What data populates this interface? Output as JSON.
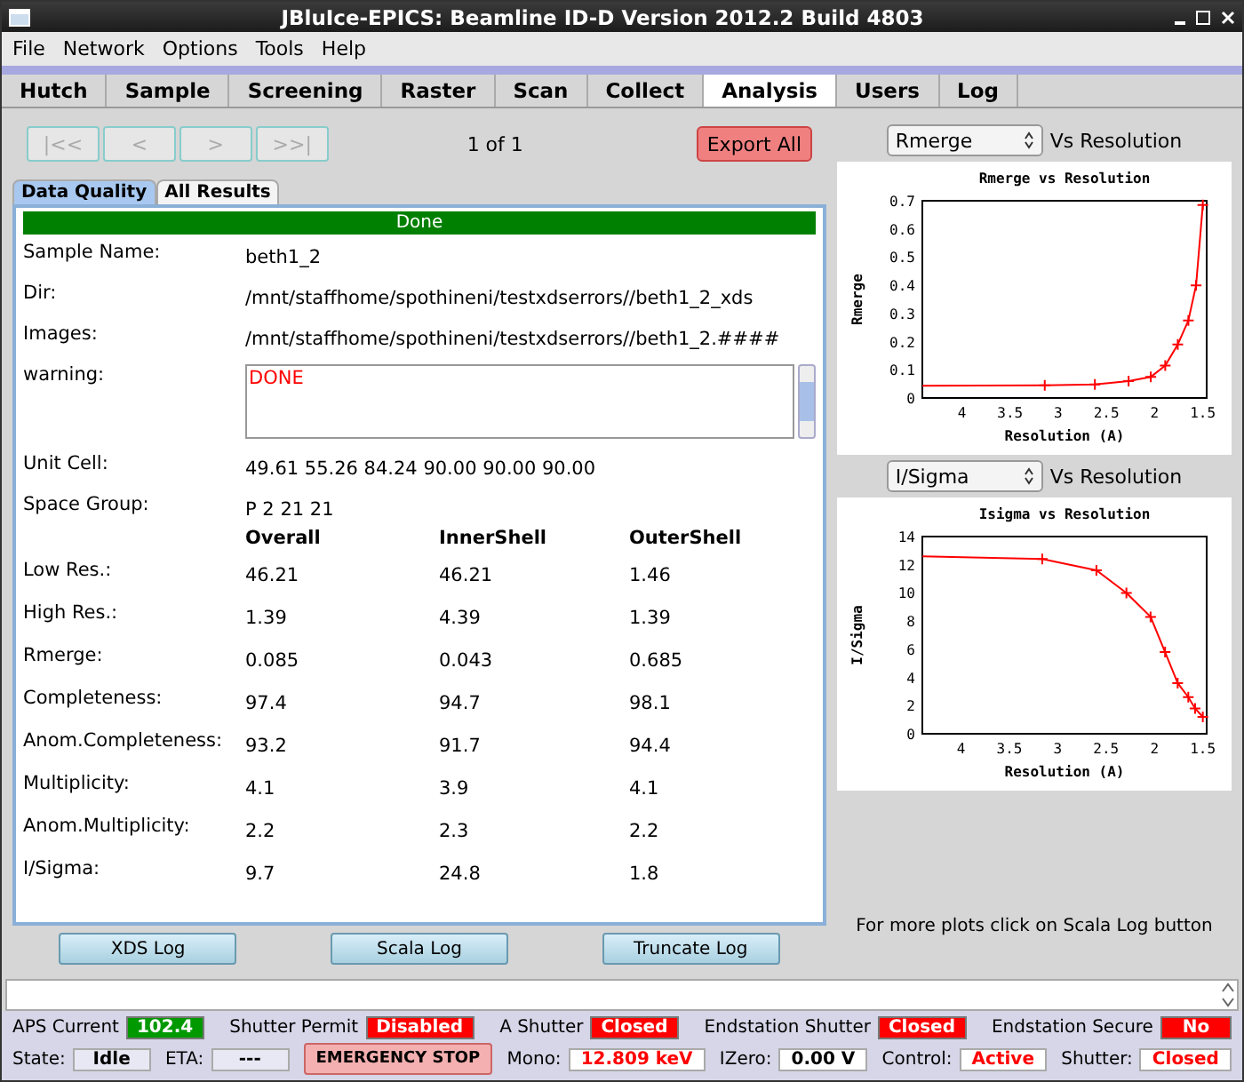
{
  "window": {
    "title": "JBluIce-EPICS: Beamline ID-D Version 2012.2 Build 4803"
  },
  "menu": [
    "File",
    "Network",
    "Options",
    "Tools",
    "Help"
  ],
  "tabs": [
    {
      "label": "Hutch",
      "selected": false
    },
    {
      "label": "Sample",
      "selected": false
    },
    {
      "label": "Screening",
      "selected": false
    },
    {
      "label": "Raster",
      "selected": false
    },
    {
      "label": "Scan",
      "selected": false
    },
    {
      "label": "Collect",
      "selected": false
    },
    {
      "label": "Analysis",
      "selected": true
    },
    {
      "label": "Users",
      "selected": false
    },
    {
      "label": "Log",
      "selected": false
    }
  ],
  "navigation": {
    "buttons": [
      {
        "label": "|<<",
        "disabled": true
      },
      {
        "label": "<",
        "disabled": true
      },
      {
        "label": ">",
        "disabled": true
      },
      {
        "label": ">>|",
        "disabled": true
      }
    ],
    "page": "1 of 1",
    "export": "Export All"
  },
  "subtabs": [
    {
      "label": "Data Quality",
      "selected": true
    },
    {
      "label": "All Results",
      "selected": false
    }
  ],
  "status_banner": "Done",
  "fields": [
    {
      "label": "Sample Name:",
      "value": "beth1_2"
    },
    {
      "label": "Dir:",
      "value": "/mnt/staffhome/spothineni/testxdserrors//beth1_2_xds"
    },
    {
      "label": "Images:",
      "value": "/mnt/staffhome/spothineni/testxdserrors//beth1_2.####"
    }
  ],
  "warning": {
    "label": "warning:",
    "value": "DONE"
  },
  "fields2": [
    {
      "label": "Unit Cell:",
      "value": "49.61  55.26 84.24 90.00 90.00 90.00"
    },
    {
      "label": "Space Group:",
      "value": "P 2 21 21"
    }
  ],
  "stats": {
    "columns": [
      "Overall",
      "InnerShell",
      "OuterShell"
    ],
    "rows": [
      {
        "label": "Low Res.:",
        "values": [
          "46.21",
          "46.21",
          "1.46"
        ]
      },
      {
        "label": "High Res.:",
        "values": [
          "1.39",
          "4.39",
          "1.39"
        ]
      },
      {
        "label": "Rmerge:",
        "values": [
          "0.085",
          "0.043",
          "0.685"
        ]
      },
      {
        "label": "Completeness:",
        "values": [
          "97.4",
          "94.7",
          "98.1"
        ]
      },
      {
        "label": "Anom.Completeness:",
        "values": [
          "93.2",
          "91.7",
          "94.4"
        ]
      },
      {
        "label": "Multiplicity:",
        "values": [
          "4.1",
          "3.9",
          "4.1"
        ]
      },
      {
        "label": "Anom.Multiplicity:",
        "values": [
          "2.2",
          "2.3",
          "2.2"
        ]
      },
      {
        "label": "I/Sigma:",
        "values": [
          "9.7",
          "24.8",
          "1.8"
        ]
      }
    ]
  },
  "log_buttons": [
    "XDS Log",
    "Scala Log",
    "Truncate Log"
  ],
  "plots": [
    {
      "selector": "Rmerge",
      "suffix": "Vs Resolution",
      "chart_data": {
        "type": "line",
        "title": "Rmerge vs Resolution",
        "xlabel": "Resolution (A)",
        "ylabel": "Rmerge",
        "x": [
          4.41,
          3.14,
          2.62,
          2.27,
          2.04,
          1.89,
          1.76,
          1.65,
          1.57,
          1.5
        ],
        "series": [
          {
            "marker": "plus",
            "color": "#ff0000",
            "values": [
              0.043,
              0.045,
              0.048,
              0.06,
              0.075,
              0.115,
              0.19,
              0.275,
              0.4,
              0.685
            ]
          }
        ],
        "xlim": [
          4.41,
          1.46
        ],
        "ylim": [
          0,
          0.7
        ],
        "xticks": [
          4,
          3.5,
          3,
          2.5,
          2,
          1.5
        ],
        "yticks": [
          0,
          0.1,
          0.2,
          0.3,
          0.4,
          0.5,
          0.6,
          0.7
        ]
      }
    },
    {
      "selector": "I/Sigma",
      "suffix": "Vs Resolution",
      "chart_data": {
        "type": "line",
        "title": "Isigma vs Resolution",
        "xlabel": "Resolution (A)",
        "ylabel": "I/Sigma",
        "x": [
          4.4,
          3.16,
          2.6,
          2.29,
          2.04,
          1.89,
          1.76,
          1.65,
          1.58,
          1.5
        ],
        "series": [
          {
            "marker": "plus",
            "color": "#ff0000",
            "values": [
              12.6,
              12.4,
              11.6,
              10.0,
              8.3,
              5.8,
              3.6,
              2.6,
              1.8,
              1.2
            ]
          }
        ],
        "xlim": [
          4.4,
          1.46
        ],
        "ylim": [
          0,
          14
        ],
        "xticks": [
          4,
          3.5,
          3,
          2.5,
          2,
          1.5
        ],
        "yticks": [
          0,
          2,
          4,
          6,
          8,
          10,
          12,
          14
        ]
      }
    }
  ],
  "plot_hint": "For more plots click on Scala Log button",
  "status_rows": [
    [
      {
        "kind": "filled",
        "label": "APS Current",
        "value": "102.4",
        "color": "#009900"
      },
      {
        "kind": "filled",
        "label": "Shutter Permit",
        "value": "Disabled",
        "color": "#ff0000"
      },
      {
        "kind": "filled",
        "label": "A Shutter",
        "value": "Closed",
        "color": "#ff0000"
      },
      {
        "kind": "filled",
        "label": "Endstation Shutter",
        "value": "Closed",
        "color": "#ff0000"
      },
      {
        "kind": "filled",
        "label": "Endstation Secure",
        "value": "No",
        "color": "#ff0000"
      }
    ],
    [
      {
        "kind": "text",
        "label": "State:",
        "value": "Idle",
        "color": "#000000"
      },
      {
        "kind": "text",
        "label": "ETA:",
        "value": "---",
        "color": "#000000"
      },
      {
        "kind": "button",
        "value": "EMERGENCY STOP",
        "color": "#000000"
      },
      {
        "kind": "text",
        "label": "Mono:",
        "value": "12.809 keV",
        "color": "#ff0000"
      },
      {
        "kind": "text",
        "label": "IZero:",
        "value": "0.00 V",
        "color": "#000000"
      },
      {
        "kind": "text",
        "label": "Control:",
        "value": "Active",
        "color": "#ff0000"
      },
      {
        "kind": "text",
        "label": "Shutter:",
        "value": "Closed",
        "color": "#ff0000"
      }
    ]
  ]
}
